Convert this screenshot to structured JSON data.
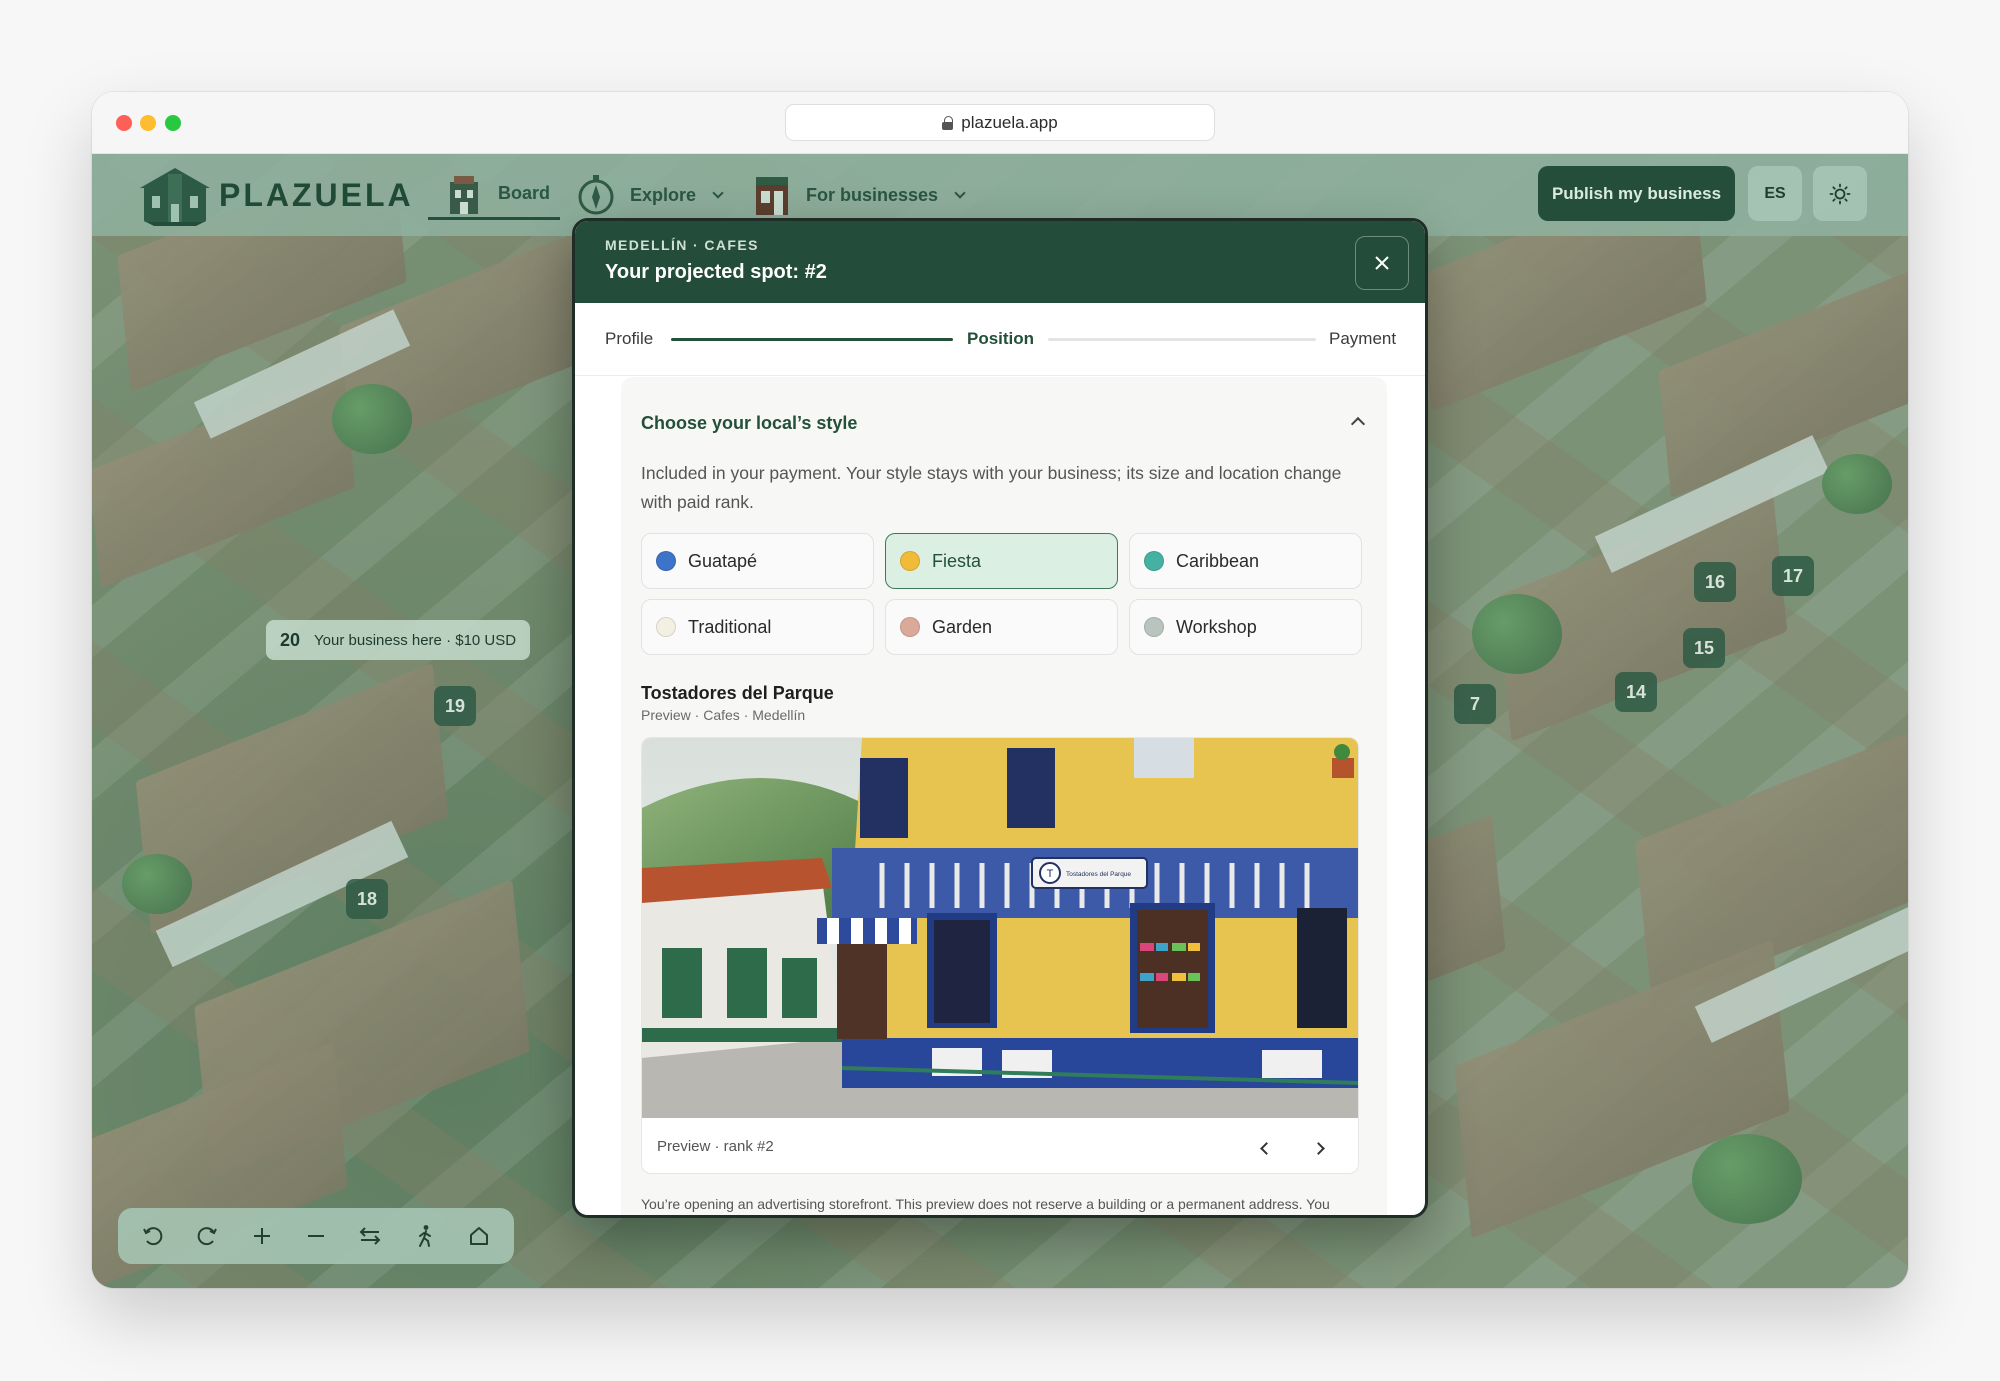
{
  "browser": {
    "url": "plazuela.app"
  },
  "nav": {
    "logo_text": "PLAZUELA",
    "items": [
      {
        "label": "Board"
      },
      {
        "label": "Explore"
      },
      {
        "label": "For businesses"
      }
    ],
    "publish_label": "Publish my business",
    "lang_label": "ES"
  },
  "map": {
    "markers": [
      "19",
      "18",
      "16",
      "17",
      "15",
      "14",
      "7"
    ],
    "business_tag": {
      "number": "20",
      "text": "Your business here · $10 USD"
    }
  },
  "modal": {
    "eyebrow": "MEDELLÍN · CAFES",
    "title": "Your projected spot: #2",
    "steps": [
      {
        "label": "Profile"
      },
      {
        "label": "Position"
      },
      {
        "label": "Payment"
      }
    ],
    "section_title": "Choose your local’s style",
    "section_desc": "Included in your payment. Your style stays with your business; its size and location change with paid rank.",
    "styles": [
      {
        "label": "Guatapé",
        "color": "#3d73c9"
      },
      {
        "label": "Fiesta",
        "color": "#f1bb3a"
      },
      {
        "label": "Caribbean",
        "color": "#45b1a3"
      },
      {
        "label": "Traditional",
        "color": "#f3efe2"
      },
      {
        "label": "Garden",
        "color": "#dba99a"
      },
      {
        "label": "Workshop",
        "color": "#b9c4bf"
      }
    ],
    "selected_style": "Fiesta",
    "preview": {
      "name": "Tostadores del Parque",
      "meta": "Preview · Cafes · Medellín",
      "sign_text": "Tostadores del Parque",
      "footer": "Preview · rank #2"
    },
    "disclaimer": "You’re opening an advertising storefront. This preview does not reserve a building or a permanent address. You can edit your style after publication."
  }
}
